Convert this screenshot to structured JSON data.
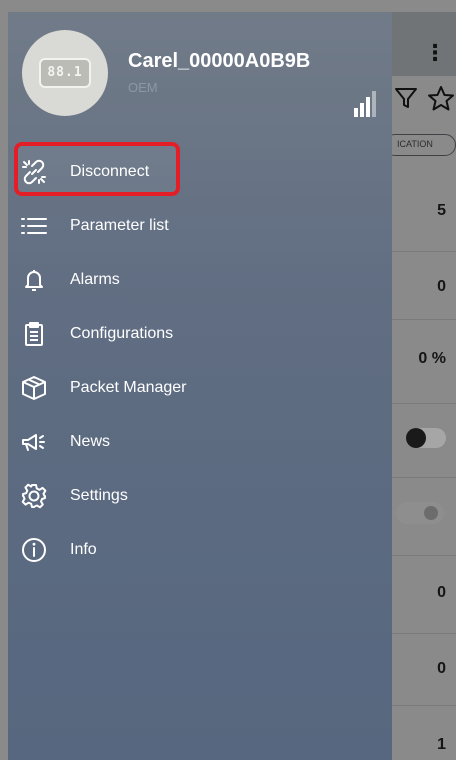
{
  "device": {
    "name": "Carel_00000A0B9B",
    "role": "OEM",
    "display_text": "88.1"
  },
  "menu": {
    "items": [
      {
        "label": "Disconnect",
        "icon": "unlink-icon"
      },
      {
        "label": "Parameter list",
        "icon": "list-icon"
      },
      {
        "label": "Alarms",
        "icon": "bell-icon"
      },
      {
        "label": "Configurations",
        "icon": "clipboard-icon"
      },
      {
        "label": "Packet Manager",
        "icon": "package-icon"
      },
      {
        "label": "News",
        "icon": "megaphone-icon"
      },
      {
        "label": "Settings",
        "icon": "gear-icon"
      },
      {
        "label": "Info",
        "icon": "info-icon"
      }
    ],
    "highlighted_item": "Disconnect"
  },
  "background": {
    "chip_text": "ICATION",
    "values": [
      "5",
      "0",
      "0 %",
      "",
      "",
      "0",
      "0",
      "1"
    ]
  },
  "colors": {
    "highlight": "#e41e26",
    "drawer_top": "#717b88",
    "drawer_bottom": "#56677f"
  }
}
